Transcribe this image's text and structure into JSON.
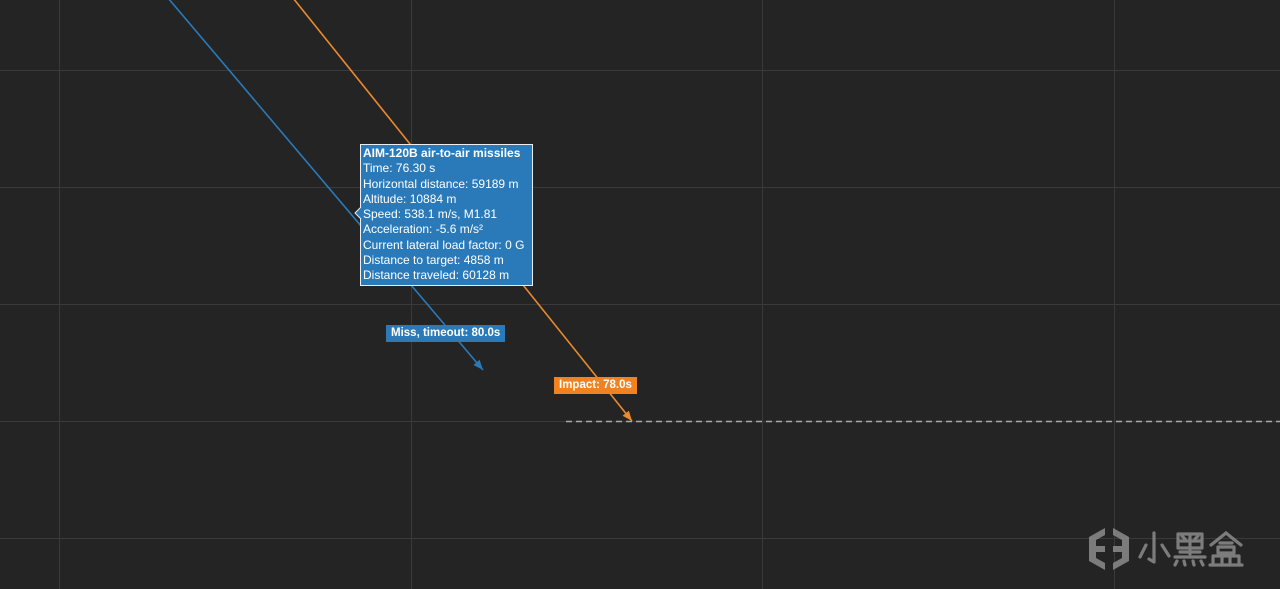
{
  "chart_data": {
    "type": "line",
    "grid": true,
    "series": [
      {
        "name": "AIM-120B air-to-air missiles",
        "color": "#2a7ab9",
        "end_label": "Miss, timeout: 80.0s"
      },
      {
        "color": "#ea8a2e",
        "end_label": "Impact: 78.0s",
        "end_label_color": "#f28220"
      }
    ],
    "tooltip": {
      "rows": [
        {
          "label": "Time:",
          "value": "76.30 s"
        },
        {
          "label": "Horizontal distance:",
          "value": "59189 m"
        },
        {
          "label": "Altitude:",
          "value": "10884 m"
        },
        {
          "label": "Speed:",
          "value": "538.1 m/s, M1.81"
        },
        {
          "label": "Acceleration:",
          "value": "-5.6 m/s²"
        },
        {
          "label": "Current lateral load factor:",
          "value": "0 G"
        },
        {
          "label": "Distance to target:",
          "value": "4858 m"
        },
        {
          "label": "Distance traveled:",
          "value": "60128 m"
        }
      ]
    },
    "reference_line_color": "#a9a9a9"
  },
  "colors": {
    "background": "#242424",
    "grid": "#3a3a3a",
    "tooltip_border": "#e9eef4"
  },
  "watermark": {
    "text": "小黑盒",
    "icon": "xiaoheihe-logo-icon",
    "color": "#8c8c8c"
  }
}
